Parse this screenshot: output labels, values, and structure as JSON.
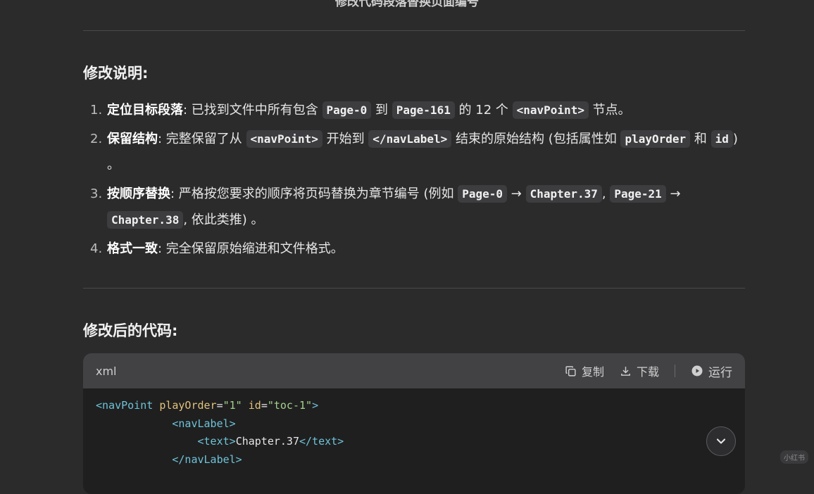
{
  "header": {
    "title_cut": "修改代码段落替换页面编号"
  },
  "explanation": {
    "heading": "修改说明:",
    "items": [
      {
        "num": "1.",
        "label": "定位目标段落",
        "t1": ": 已找到文件中所有包含 ",
        "c1": "Page-0",
        "t2": " 到 ",
        "c2": "Page-161",
        "t3": " 的 12 个 ",
        "c3": "<navPoint>",
        "t4": " 节点。"
      },
      {
        "num": "2.",
        "label": "保留结构",
        "t1": ": 完整保留了从 ",
        "c1": "<navPoint>",
        "t2": " 开始到 ",
        "c2": "</navLabel>",
        "t3": " 结束的原始结构 (包括属性如 ",
        "c3": "playOrder",
        "t4": " 和 ",
        "c4": "id",
        "t5": ") 。"
      },
      {
        "num": "3.",
        "label": "按顺序替换",
        "t1": ": 严格按您要求的顺序将页码替换为章节编号 (例如 ",
        "c1": "Page-0",
        "t2": " → ",
        "c2": "Chapter.37",
        "t3": ", ",
        "c3": "Page-21",
        "t4": " → ",
        "c4": "Chapter.38",
        "t5": ", 依此类推) 。"
      },
      {
        "num": "4.",
        "label": "格式一致",
        "t1": ": 完全保留原始缩进和文件格式。"
      }
    ]
  },
  "code_section": {
    "heading": "修改后的代码:",
    "lang": "xml",
    "copy_label": "复制",
    "download_label": "下载",
    "run_label": "运行",
    "lines": {
      "l1_open": "<navPoint ",
      "l1_attr1": "playOrder",
      "l1_eq1": "=",
      "l1_val1": "\"1\"",
      "l1_attr2": " id",
      "l1_eq2": "=",
      "l1_val2": "\"toc-1\"",
      "l1_close": ">",
      "l2": "<navLabel>",
      "l3_open": "<text>",
      "l3_text": "Chapter.37",
      "l3_close": "</text>",
      "l4": "</navLabel>"
    }
  },
  "watermark": "小红书",
  "icons": [
    "copy-icon",
    "download-icon",
    "run-icon",
    "chevron-down-icon"
  ]
}
